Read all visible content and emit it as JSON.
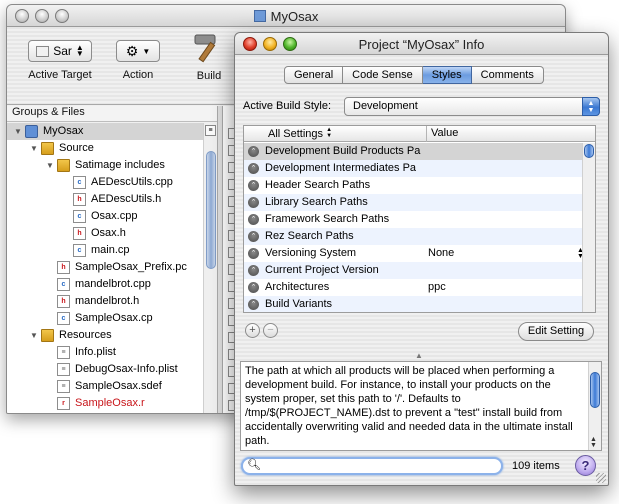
{
  "main_window": {
    "title": "MyOsax",
    "toolbar": {
      "active_target": {
        "value": "Sar",
        "label": "Active Target"
      },
      "action": {
        "label": "Action"
      },
      "build": {
        "label": "Build"
      }
    },
    "groups_header": "Groups & Files",
    "tree": [
      {
        "label": "MyOsax",
        "icon": "project-icon",
        "depth": 0,
        "disclosure": "open",
        "selected": true
      },
      {
        "label": "Source",
        "icon": "folder-icon",
        "depth": 1,
        "disclosure": "open"
      },
      {
        "label": "Satimage includes",
        "icon": "folder-icon",
        "depth": 2,
        "disclosure": "open"
      },
      {
        "label": "AEDescUtils.cpp",
        "icon": "cpp-file-icon",
        "depth": 3
      },
      {
        "label": "AEDescUtils.h",
        "icon": "header-file-icon",
        "depth": 3
      },
      {
        "label": "Osax.cpp",
        "icon": "cpp-file-icon",
        "depth": 3
      },
      {
        "label": "Osax.h",
        "icon": "header-file-icon",
        "depth": 3
      },
      {
        "label": "main.cp",
        "icon": "cpp-file-icon",
        "depth": 3
      },
      {
        "label": "SampleOsax_Prefix.pc",
        "icon": "header-file-icon",
        "depth": 2
      },
      {
        "label": "mandelbrot.cpp",
        "icon": "cpp-file-icon",
        "depth": 2
      },
      {
        "label": "mandelbrot.h",
        "icon": "header-file-icon",
        "depth": 2
      },
      {
        "label": "SampleOsax.cp",
        "icon": "cpp-file-icon",
        "depth": 2
      },
      {
        "label": "Resources",
        "icon": "folder-icon",
        "depth": 1,
        "disclosure": "open"
      },
      {
        "label": "Info.plist",
        "icon": "plist-file-icon",
        "depth": 2
      },
      {
        "label": "DebugOsax-Info.plist",
        "icon": "plist-file-icon",
        "depth": 2
      },
      {
        "label": "SampleOsax.sdef",
        "icon": "plist-file-icon",
        "depth": 2
      },
      {
        "label": "SampleOsax.r",
        "icon": "rez-file-icon",
        "depth": 2,
        "color": "#c8151a"
      }
    ]
  },
  "info_window": {
    "title": "Project “MyOsax” Info",
    "tabs": [
      "General",
      "Code Sense",
      "Styles",
      "Comments"
    ],
    "active_tab": "Styles",
    "build_style_label": "Active Build Style:",
    "build_style_value": "Development",
    "table_headers": {
      "settings": "All Settings",
      "value": "Value"
    },
    "settings_rows": [
      {
        "name": "Development Build Products Pa",
        "value": ""
      },
      {
        "name": "Development Intermediates Pa",
        "value": ""
      },
      {
        "name": "Header Search Paths",
        "value": ""
      },
      {
        "name": "Library Search Paths",
        "value": ""
      },
      {
        "name": "Framework Search Paths",
        "value": ""
      },
      {
        "name": "Rez Search Paths",
        "value": ""
      },
      {
        "name": "Versioning System",
        "value": "None"
      },
      {
        "name": "Current Project Version",
        "value": ""
      },
      {
        "name": "Architectures",
        "value": "ppc"
      },
      {
        "name": "Build Variants",
        "value": ""
      }
    ],
    "edit_setting_label": "Edit Setting",
    "add_glyph": "+",
    "remove_glyph": "−",
    "description": "The path at which all products will be placed when performing a development build.  For instance, to install your products on the system proper, set this path to '/'.  Defaults to /tmp/$(PROJECT_NAME).dst to prevent a \"test\" install build from accidentally overwriting valid and needed data in the ultimate install path.",
    "search_placeholder": "",
    "item_count": "109 items",
    "help_glyph": "?"
  }
}
